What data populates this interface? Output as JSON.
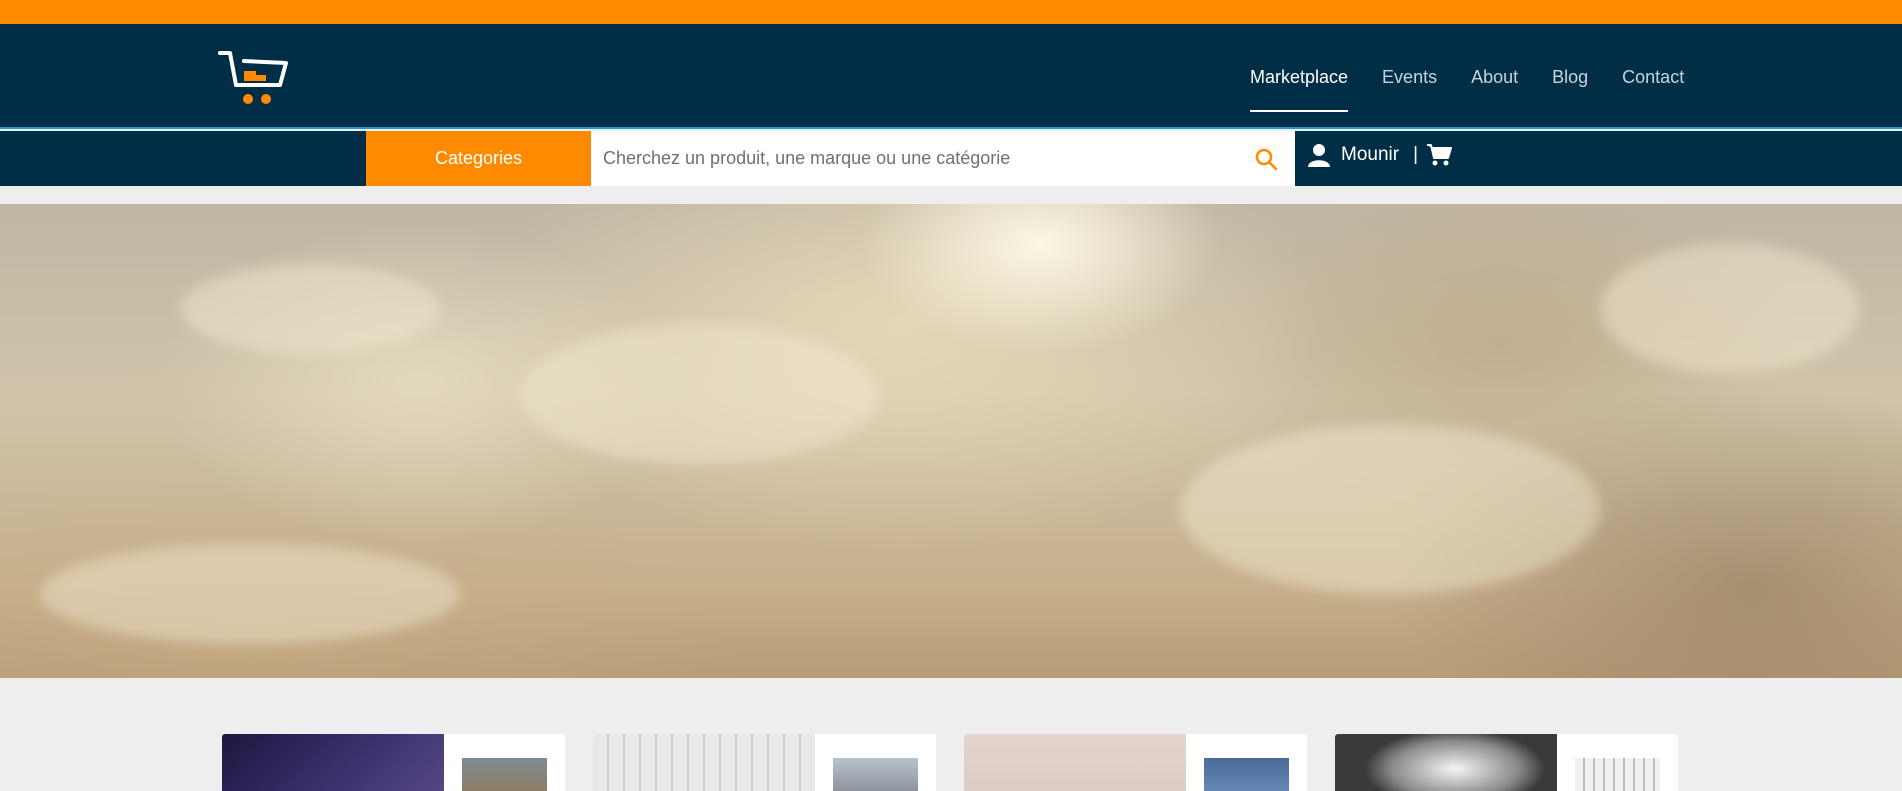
{
  "colors": {
    "accent": "#ff8a00",
    "header_bg": "#002e47",
    "header_border": "#1c9bd1",
    "page_bg": "#eeeeee"
  },
  "header": {
    "logo_icon": "shopping-cart-logo",
    "nav": [
      {
        "label": "Marketplace",
        "active": true
      },
      {
        "label": "Events",
        "active": false
      },
      {
        "label": "About",
        "active": false
      },
      {
        "label": "Blog",
        "active": false
      },
      {
        "label": "Contact",
        "active": false
      }
    ]
  },
  "subbar": {
    "categories_label": "Categories",
    "search": {
      "placeholder": "Cherchez un produit, une marque ou une catégorie",
      "value": "",
      "icon": "search-icon"
    },
    "user": {
      "icon": "user-icon",
      "name": "Mounir",
      "separator": "|",
      "cart_icon": "cart-icon"
    }
  },
  "hero": {
    "image": "sunlit-clouds-banner"
  },
  "cards": [
    {
      "main_image": "bridge-night-photo",
      "thumb_image": "city-street-photo"
    },
    {
      "main_image": "typography-sketch-photo",
      "thumb_image": "city-skyline-photo"
    },
    {
      "main_image": "pink-wall-photo",
      "thumb_image": "blue-sky-tower-photo"
    },
    {
      "main_image": "black-white-clouds-photo",
      "thumb_image": "letterpress-photo"
    }
  ]
}
